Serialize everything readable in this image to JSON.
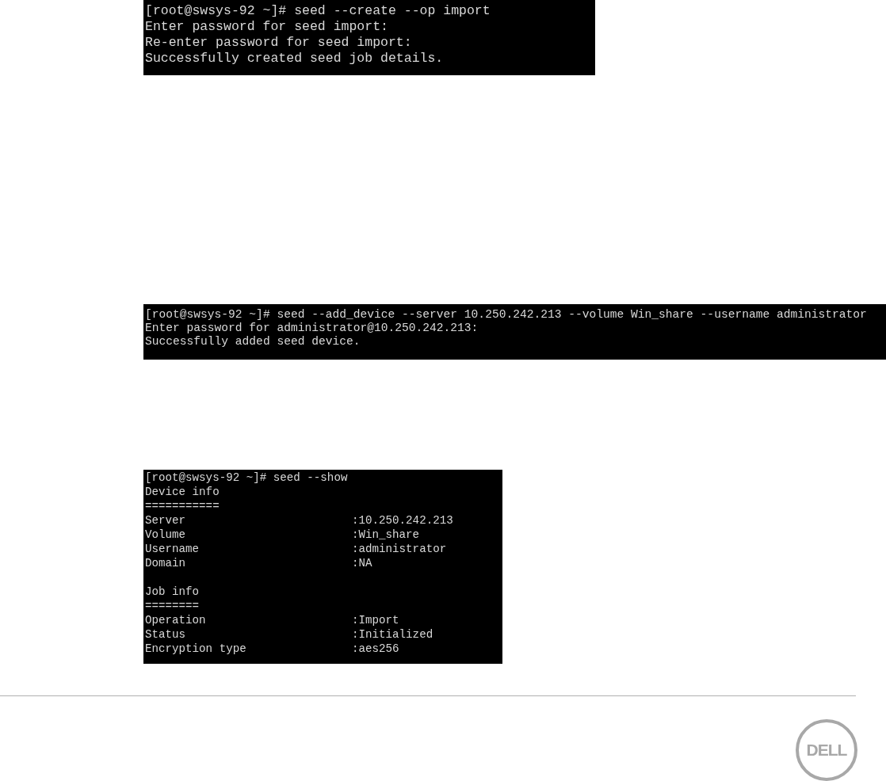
{
  "terminals": [
    {
      "lines": [
        {
          "kind": "text",
          "text": "[root@swsys-92 ~]# seed --create --op import"
        },
        {
          "kind": "text",
          "text": "Enter password for seed import:"
        },
        {
          "kind": "text",
          "text": "Re-enter password for seed import:"
        },
        {
          "kind": "text",
          "text": "Successfully created seed job details."
        }
      ]
    },
    {
      "lines": [
        {
          "kind": "text",
          "text": "[root@swsys-92 ~]# seed --add_device --server 10.250.242.213 --volume Win_share --username administrator"
        },
        {
          "kind": "text",
          "text": "Enter password for administrator@10.250.242.213:"
        },
        {
          "kind": "text",
          "text": "Successfully added seed device."
        }
      ]
    },
    {
      "lines": [
        {
          "kind": "text",
          "text": "[root@swsys-92 ~]# seed --show"
        },
        {
          "kind": "text",
          "text": "Device info"
        },
        {
          "kind": "text",
          "text": "==========="
        },
        {
          "kind": "field",
          "key": "Server",
          "value": ":10.250.242.213"
        },
        {
          "kind": "field",
          "key": "Volume",
          "value": ":Win_share"
        },
        {
          "kind": "field",
          "key": "Username",
          "value": ":administrator"
        },
        {
          "kind": "field",
          "key": "Domain",
          "value": ":NA"
        },
        {
          "kind": "blank"
        },
        {
          "kind": "text",
          "text": "Job info"
        },
        {
          "kind": "text",
          "text": "========"
        },
        {
          "kind": "field",
          "key": "Operation",
          "value": ":Import"
        },
        {
          "kind": "field",
          "key": "Status",
          "value": ":Initialized"
        },
        {
          "kind": "field",
          "key": "Encryption type",
          "value": ":aes256"
        }
      ]
    }
  ],
  "logo": "DELL"
}
